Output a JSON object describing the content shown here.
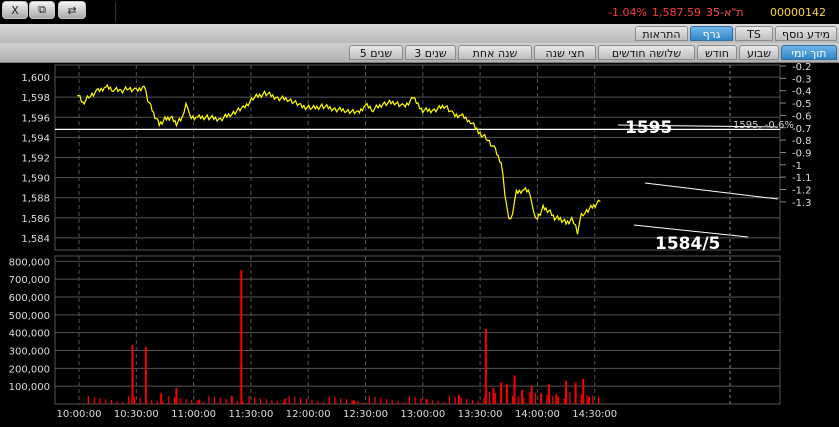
{
  "window_buttons": {
    "close_label": "X",
    "restore_label": "⧉",
    "app_label": "⇄"
  },
  "quote_bar": {
    "change_pct": "-1.04%",
    "last_price": "1,587.59",
    "index_name": "ת\"א-35",
    "security_id": "00000142"
  },
  "tabs_top": [
    {
      "label": "מידע נוסף",
      "active": false
    },
    {
      "label": "TS",
      "active": false
    },
    {
      "label": "גרף",
      "active": true
    },
    {
      "label": "התראות",
      "active": false
    }
  ],
  "tabs_range": [
    {
      "label": "תוך יומי",
      "active": true
    },
    {
      "label": "שבוע",
      "active": false
    },
    {
      "label": "חודש",
      "active": false
    },
    {
      "label": "שלושה חודשים",
      "active": false
    },
    {
      "label": "חצי שנה",
      "active": false
    },
    {
      "label": "שנה אחת",
      "active": false
    },
    {
      "label": "3 שנים",
      "active": false
    },
    {
      "label": "5 שנים",
      "active": false
    }
  ],
  "colors": {
    "price_line": "#ffff00",
    "volume_bars": "#ff0000",
    "background": "#000000",
    "grid": "#555555",
    "annotation": "#ffffff"
  },
  "chart_data": [
    {
      "type": "line",
      "title": "",
      "x_label": "",
      "left_axis": {
        "ticks": [
          "1,584",
          "1,586",
          "1,588",
          "1,590",
          "1,592",
          "1,594",
          "1,596",
          "1,598",
          "1,600"
        ],
        "ylim": [
          1582.8,
          1601.2
        ]
      },
      "right_axis": {
        "ticks": [
          "-0.2",
          "-0.3",
          "-0.4",
          "-0.5",
          "-0.6",
          "-0.7",
          "-0.8",
          "-0.9",
          "-1",
          "-1.1",
          "-1.2",
          "-1.3"
        ],
        "unit": "%"
      },
      "x_ticks": [
        "10:00:00",
        "10:30:00",
        "11:00:00",
        "11:30:00",
        "12:00:00",
        "12:30:00",
        "13:00:00",
        "13:30:00",
        "14:00:00",
        "14:30:00"
      ],
      "series": [
        {
          "values": [
            {
              "t": "09:59",
              "y": 1598.4
            },
            {
              "t": "10:02",
              "y": 1597.4
            },
            {
              "t": "10:06",
              "y": 1598.2
            },
            {
              "t": "10:10",
              "y": 1598.6
            },
            {
              "t": "10:14",
              "y": 1599.0
            },
            {
              "t": "10:18",
              "y": 1598.8
            },
            {
              "t": "10:22",
              "y": 1598.6
            },
            {
              "t": "10:26",
              "y": 1598.9
            },
            {
              "t": "10:30",
              "y": 1598.6
            },
            {
              "t": "10:34",
              "y": 1599.1
            },
            {
              "t": "10:36",
              "y": 1597.8
            },
            {
              "t": "10:39",
              "y": 1596.4
            },
            {
              "t": "10:42",
              "y": 1595.3
            },
            {
              "t": "10:45",
              "y": 1595.8
            },
            {
              "t": "10:48",
              "y": 1596.0
            },
            {
              "t": "10:51",
              "y": 1595.4
            },
            {
              "t": "10:54",
              "y": 1595.9
            },
            {
              "t": "10:56",
              "y": 1597.5
            },
            {
              "t": "10:58",
              "y": 1596.0
            },
            {
              "t": "11:02",
              "y": 1596.0
            },
            {
              "t": "11:08",
              "y": 1596.0
            },
            {
              "t": "11:14",
              "y": 1595.8
            },
            {
              "t": "11:20",
              "y": 1596.4
            },
            {
              "t": "11:26",
              "y": 1596.9
            },
            {
              "t": "11:32",
              "y": 1598.0
            },
            {
              "t": "11:38",
              "y": 1598.4
            },
            {
              "t": "11:44",
              "y": 1597.9
            },
            {
              "t": "11:50",
              "y": 1597.8
            },
            {
              "t": "11:56",
              "y": 1597.1
            },
            {
              "t": "12:02",
              "y": 1596.9
            },
            {
              "t": "12:08",
              "y": 1597.1
            },
            {
              "t": "12:14",
              "y": 1596.8
            },
            {
              "t": "12:20",
              "y": 1596.7
            },
            {
              "t": "12:26",
              "y": 1596.4
            },
            {
              "t": "12:30",
              "y": 1597.2
            },
            {
              "t": "12:34",
              "y": 1596.8
            },
            {
              "t": "12:40",
              "y": 1597.4
            },
            {
              "t": "12:46",
              "y": 1597.5
            },
            {
              "t": "12:50",
              "y": 1597.0
            },
            {
              "t": "12:55",
              "y": 1597.9
            },
            {
              "t": "13:00",
              "y": 1596.7
            },
            {
              "t": "13:06",
              "y": 1596.7
            },
            {
              "t": "13:12",
              "y": 1597.2
            },
            {
              "t": "13:16",
              "y": 1596.2
            },
            {
              "t": "13:20",
              "y": 1596.2
            },
            {
              "t": "13:25",
              "y": 1595.6
            },
            {
              "t": "13:30",
              "y": 1594.4
            },
            {
              "t": "13:34",
              "y": 1593.8
            },
            {
              "t": "13:38",
              "y": 1592.7
            },
            {
              "t": "13:41",
              "y": 1591.5
            },
            {
              "t": "13:43",
              "y": 1588.5
            },
            {
              "t": "13:45",
              "y": 1585.8
            },
            {
              "t": "13:47",
              "y": 1586.5
            },
            {
              "t": "13:49",
              "y": 1588.5
            },
            {
              "t": "13:53",
              "y": 1588.8
            },
            {
              "t": "13:56",
              "y": 1588.6
            },
            {
              "t": "13:58",
              "y": 1586.5
            },
            {
              "t": "14:00",
              "y": 1586.0
            },
            {
              "t": "14:03",
              "y": 1587.0
            },
            {
              "t": "14:06",
              "y": 1586.7
            },
            {
              "t": "14:09",
              "y": 1586.0
            },
            {
              "t": "14:12",
              "y": 1585.9
            },
            {
              "t": "14:15",
              "y": 1585.5
            },
            {
              "t": "14:18",
              "y": 1585.8
            },
            {
              "t": "14:20",
              "y": 1585.3
            },
            {
              "t": "14:21",
              "y": 1584.6
            },
            {
              "t": "14:23",
              "y": 1586.3
            },
            {
              "t": "14:25",
              "y": 1586.6
            },
            {
              "t": "14:28",
              "y": 1587.0
            },
            {
              "t": "14:31",
              "y": 1587.4
            },
            {
              "t": "14:33",
              "y": 1587.6
            }
          ]
        }
      ],
      "reference_line": {
        "value": 1594.8
      },
      "annotations": [
        {
          "text": "1595"
        },
        {
          "text": "1584/5"
        },
        {
          "text": "1595, -0.6%"
        }
      ]
    },
    {
      "type": "bar",
      "title": "",
      "y_ticks": [
        "100,000",
        "200,000",
        "300,000",
        "400,000",
        "500,000",
        "600,000",
        "700,000",
        "800,000"
      ],
      "ylim": [
        0,
        830000
      ],
      "x_ticks": [
        "10:00:00",
        "10:30:00",
        "11:00:00",
        "11:30:00",
        "12:00:00",
        "12:30:00",
        "13:00:00",
        "13:30:00",
        "14:00:00",
        "14:30:00"
      ],
      "series": [
        {
          "values": [
            {
              "t": "10:28",
              "v": 330000
            },
            {
              "t": "10:35",
              "v": 320000
            },
            {
              "t": "10:43",
              "v": 60000
            },
            {
              "t": "10:51",
              "v": 90000
            },
            {
              "t": "11:03",
              "v": 25000
            },
            {
              "t": "11:20",
              "v": 45000
            },
            {
              "t": "11:25",
              "v": 750000
            },
            {
              "t": "11:48",
              "v": 30000
            },
            {
              "t": "12:24",
              "v": 20000
            },
            {
              "t": "13:02",
              "v": 28000
            },
            {
              "t": "13:19",
              "v": 50000
            },
            {
              "t": "13:33",
              "v": 420000
            },
            {
              "t": "13:37",
              "v": 90000
            },
            {
              "t": "13:41",
              "v": 120000
            },
            {
              "t": "13:44",
              "v": 110000
            },
            {
              "t": "13:48",
              "v": 160000
            },
            {
              "t": "13:52",
              "v": 80000
            },
            {
              "t": "13:57",
              "v": 100000
            },
            {
              "t": "14:02",
              "v": 60000
            },
            {
              "t": "14:06",
              "v": 110000
            },
            {
              "t": "14:10",
              "v": 55000
            },
            {
              "t": "14:15",
              "v": 130000
            },
            {
              "t": "14:20",
              "v": 120000
            },
            {
              "t": "14:24",
              "v": 140000
            },
            {
              "t": "14:27",
              "v": 40000
            }
          ]
        }
      ]
    }
  ]
}
